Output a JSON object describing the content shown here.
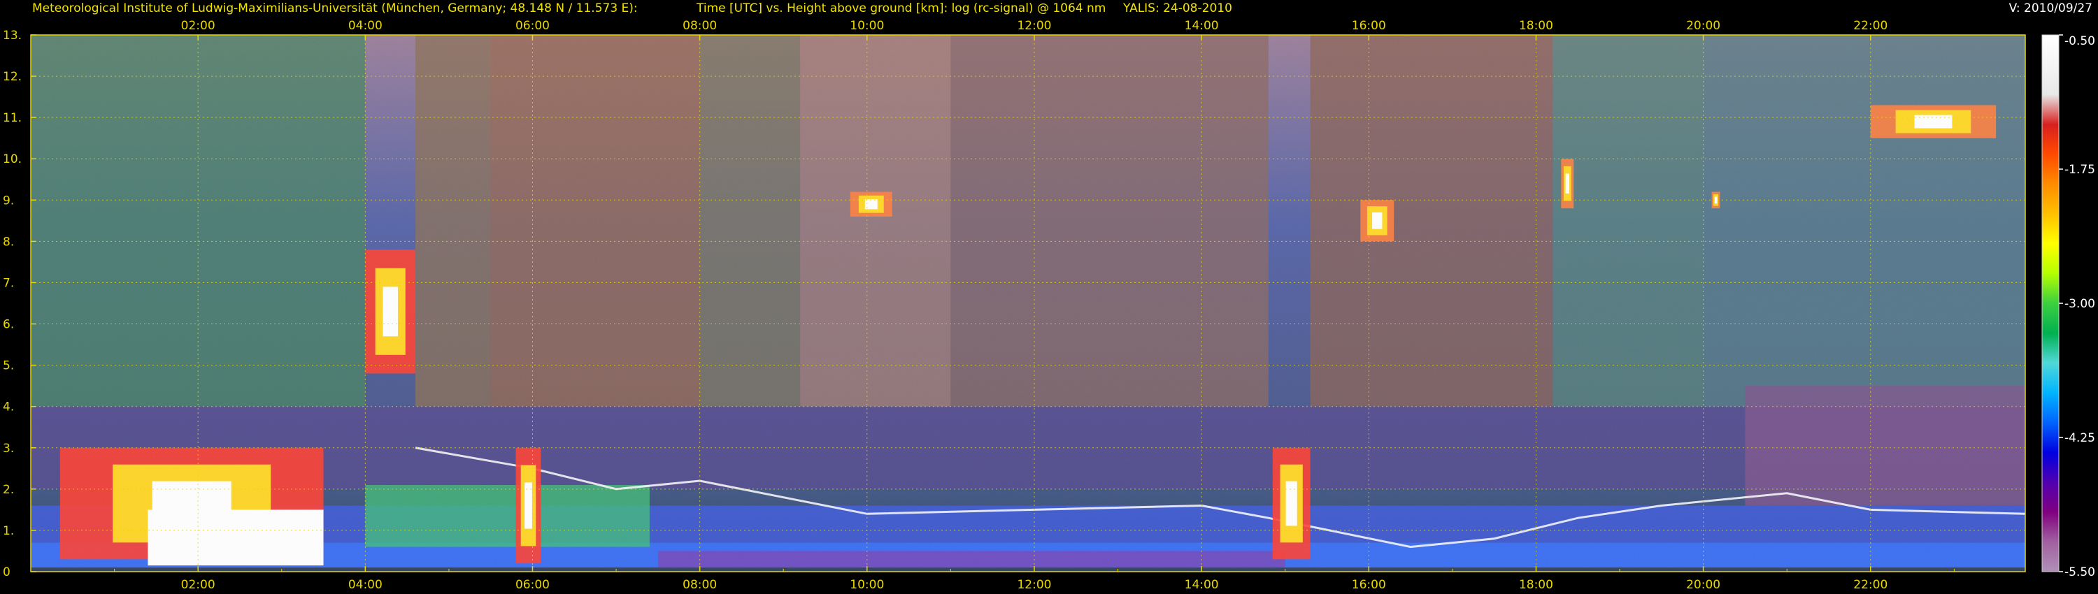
{
  "header": {
    "institute": "Meteorological Institute of Ludwig-Maximilians-Universität (München, Germany; 48.148 N / 11.573 E):",
    "plot_description": "Time [UTC] vs. Height above ground [km]: log (rc-signal) @ 1064 nm",
    "instrument_date": "YALIS: 24-08-2010",
    "version": "V: 2010/09/27"
  },
  "chart_data": {
    "type": "heatmap",
    "title": "Time [UTC] vs. Height above ground [km]: log (rc-signal) @ 1064 nm",
    "xlabel": "Time [UTC]",
    "ylabel": "Height above ground [km]",
    "x_ticks": [
      "02:00",
      "04:00",
      "06:00",
      "08:00",
      "10:00",
      "12:00",
      "14:00",
      "16:00",
      "18:00",
      "20:00",
      "22:00"
    ],
    "x_tick_hours": [
      2,
      4,
      6,
      8,
      10,
      12,
      14,
      16,
      18,
      20,
      22
    ],
    "xlim_hours": [
      0.0,
      23.85
    ],
    "y_ticks": [
      "0",
      "1.",
      "2.",
      "3.",
      "4.",
      "5.",
      "6.",
      "7.",
      "8.",
      "9.",
      "10.",
      "11.",
      "12.",
      "13."
    ],
    "ylim_km": [
      0,
      13
    ],
    "grid": true,
    "colorbar": {
      "ticks": [
        "-0.50",
        "-1.75",
        "-3.00",
        "-4.25",
        "-5.50"
      ],
      "tick_values": [
        -0.5,
        -1.75,
        -3.0,
        -4.25,
        -5.5
      ],
      "range": [
        -5.5,
        -0.5
      ],
      "colors_high_to_low": [
        "#ffffff",
        "#f4f4f4",
        "#e8e8e8",
        "#d82020",
        "#ff4a00",
        "#ff8c00",
        "#ffc000",
        "#ffff00",
        "#b4ff00",
        "#3cd040",
        "#00b050",
        "#50d8d8",
        "#00b4ff",
        "#0064ff",
        "#0000e0",
        "#5000b0",
        "#800080",
        "#a060a0",
        "#b090b8"
      ]
    },
    "features": [
      {
        "name": "boundary layer aerosol",
        "start_h": 0.0,
        "end_h": 23.85,
        "base_km": 0.1,
        "top_km": 1.6
      },
      {
        "name": "low cloud",
        "start_h": 0.35,
        "end_h": 3.5,
        "base_km": 0.3,
        "top_km": 3.0
      },
      {
        "name": "cloud",
        "start_h": 4.0,
        "end_h": 4.6,
        "base_km": 4.8,
        "top_km": 7.8
      },
      {
        "name": "cloud",
        "start_h": 5.8,
        "end_h": 6.1,
        "base_km": 0.2,
        "top_km": 3.0
      },
      {
        "name": "cloud",
        "start_h": 14.85,
        "end_h": 15.3,
        "base_km": 0.3,
        "top_km": 3.0
      },
      {
        "name": "cirrus",
        "start_h": 9.8,
        "end_h": 10.3,
        "base_km": 8.6,
        "top_km": 9.2
      },
      {
        "name": "cirrus",
        "start_h": 15.9,
        "end_h": 16.3,
        "base_km": 8.0,
        "top_km": 9.0
      },
      {
        "name": "cirrus",
        "start_h": 18.3,
        "end_h": 18.45,
        "base_km": 8.8,
        "top_km": 10.0
      },
      {
        "name": "cirrus",
        "start_h": 20.1,
        "end_h": 20.2,
        "base_km": 8.8,
        "top_km": 9.2
      },
      {
        "name": "cirrus",
        "start_h": 22.0,
        "end_h": 23.5,
        "base_km": 10.5,
        "top_km": 11.3
      }
    ]
  }
}
